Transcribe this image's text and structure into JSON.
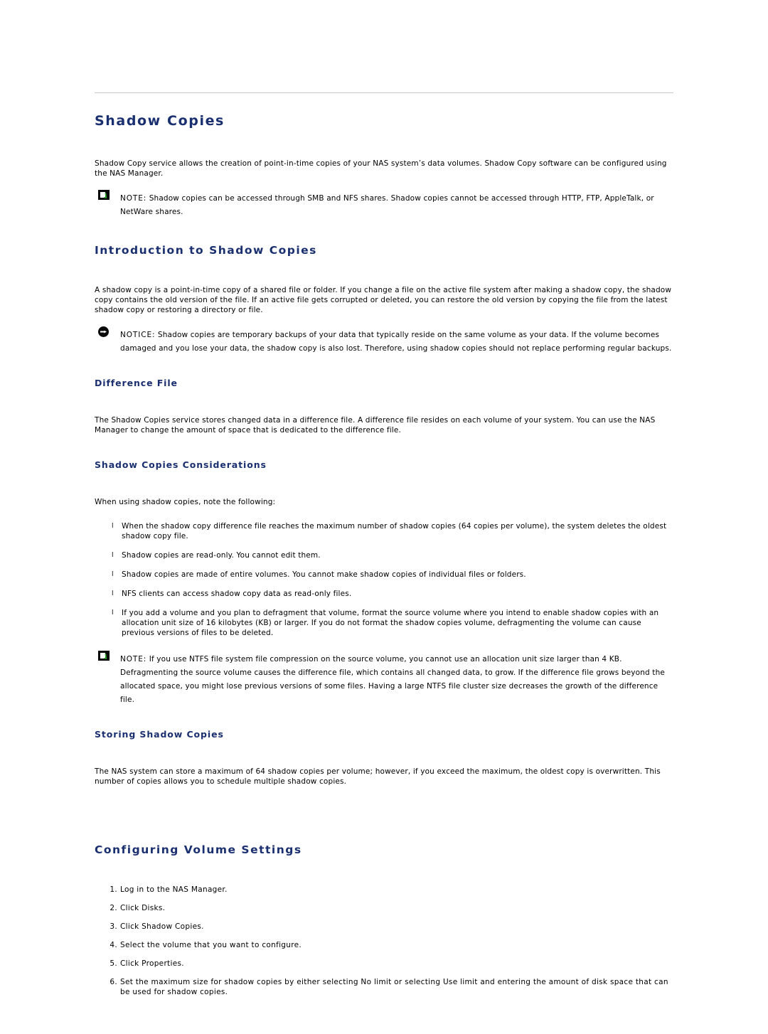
{
  "document": {
    "title": "Shadow Copies",
    "intro": "Shadow Copy service allows the creation of point-in-time copies of your NAS system’s data volumes. Shadow Copy software can be configured using the NAS Manager.",
    "note_top": {
      "label": "NOTE:",
      "text": " Shadow copies can be accessed through SMB and NFS shares. Shadow copies cannot be accessed through HTTP, FTP, AppleTalk, or NetWare shares.",
      "icon": "note-icon"
    },
    "sections": [
      {
        "heading": "Introduction to Shadow Copies",
        "paragraph": "A shadow copy is a point-in-time copy of a shared file or folder. If you change a file on the active file system after making a shadow copy, the shadow copy contains the old version of the file. If an active file gets corrupted or deleted, you can restore the old version by copying the file from the latest shadow copy or restoring a directory or file.",
        "notice": {
          "label": "NOTICE:",
          "text": " Shadow copies are temporary backups of your data that typically reside on the same volume as your data. If the volume becomes damaged and you lose your data, the shadow copy is also lost. Therefore, using shadow copies should not replace performing regular backups.",
          "icon": "notice-icon"
        },
        "subsections": [
          {
            "heading": "Difference File",
            "paragraph": "The Shadow Copies service stores changed data in a difference file. A difference file resides on each volume of your system. You can use the NAS Manager to change the amount of space that is dedicated to the difference file."
          },
          {
            "heading": "Shadow Copies Considerations",
            "paragraph": "When using shadow copies, note the following:",
            "bullets": [
              "When the shadow copy difference file reaches the maximum number of shadow copies (64 copies per volume), the system deletes the oldest shadow copy file.",
              "Shadow copies are read-only. You cannot edit them.",
              "Shadow copies are made of entire volumes. You cannot make shadow copies of individual files or folders.",
              "NFS clients can access shadow copy data as read-only files.",
              "If you add a volume and you plan to defragment that volume, format the source volume where you intend to enable shadow copies with an allocation unit size of 16 kilobytes (KB) or larger. If you do not format the shadow copies volume, defragmenting the volume can cause previous versions of files to be deleted."
            ],
            "note": {
              "label": "NOTE:",
              "text": " If you use NTFS file system file compression on the source volume, you cannot use an allocation unit size larger than 4 KB. Defragmenting the source volume causes the difference file, which contains all changed data, to grow. If the difference file grows beyond the allocated space, you might lose previous versions of some files. Having a large NTFS file cluster size decreases the growth of the difference file.",
              "icon": "note-icon"
            }
          },
          {
            "heading": "Storing Shadow Copies",
            "paragraph": "The NAS system can store a maximum of 64 shadow copies per volume; however, if you exceed the maximum, the oldest copy is overwritten. This number of copies allows you to schedule multiple shadow copies."
          }
        ]
      },
      {
        "heading": "Configuring Volume Settings",
        "steps": [
          "Log in to the NAS Manager.",
          "Click Disks.",
          "Click Shadow Copies.",
          "Select the volume that you want to configure.",
          "Click Properties.",
          "Set the maximum size for shadow copies by either selecting No limit or selecting Use limit and entering the amount of disk space that can be used for shadow copies."
        ]
      }
    ],
    "colors": {
      "heading": "#1a2f6f",
      "rule": "#c8c8c8",
      "note_check": "#2ba82b"
    }
  }
}
